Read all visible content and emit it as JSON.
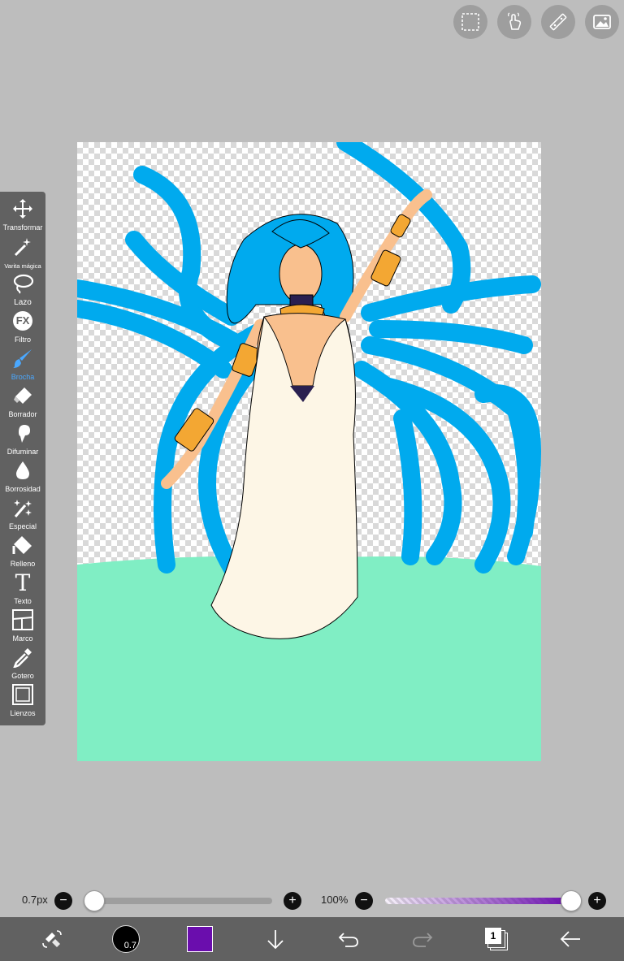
{
  "top_icons": [
    "selection-icon",
    "gesture-icon",
    "ruler-icon",
    "image-icon"
  ],
  "toolbar": {
    "tools": [
      {
        "label": "Transformar",
        "icon": "move-icon"
      },
      {
        "label": "Varita mágica",
        "icon": "magic-wand-icon"
      },
      {
        "label": "Lazo",
        "icon": "lasso-icon"
      },
      {
        "label": "Filtro",
        "icon": "fx-icon"
      },
      {
        "label": "Brocha",
        "icon": "brush-icon",
        "active": true
      },
      {
        "label": "Borrador",
        "icon": "eraser-icon"
      },
      {
        "label": "Difuminar",
        "icon": "smudge-icon"
      },
      {
        "label": "Borrosidad",
        "icon": "blur-drop-icon"
      },
      {
        "label": "Especial",
        "icon": "special-brush-icon"
      },
      {
        "label": "Relleno",
        "icon": "fill-bucket-icon"
      },
      {
        "label": "Texto",
        "icon": "text-icon"
      },
      {
        "label": "Marco",
        "icon": "frame-divider-icon"
      },
      {
        "label": "Gotero",
        "icon": "eyedropper-icon"
      },
      {
        "label": "Lienzos",
        "icon": "canvas-icon"
      }
    ],
    "fx_text": "FX",
    "text_glyph": "T"
  },
  "brush": {
    "size_label": "0.7px",
    "size_value": 0.7,
    "size_slider_fraction": 0.0,
    "size_badge": "0.7",
    "opacity_label": "100%",
    "opacity_fraction": 1.0,
    "minus": "−",
    "plus": "+"
  },
  "colors": {
    "current_color": "#6a0dad",
    "hair": "#00aaee",
    "ground": "#80eec4",
    "dress": "#fdf6e6",
    "skin": "#f9c08e",
    "gold": "#f3a733",
    "accent_active": "#4aa8ff"
  },
  "bottom_bar": {
    "layer_count": "1",
    "icons": [
      "swap-colors-icon",
      "brush-size-icon",
      "color-swatch",
      "download-icon",
      "undo-icon",
      "redo-icon",
      "layers-icon",
      "back-arrow-icon"
    ]
  }
}
